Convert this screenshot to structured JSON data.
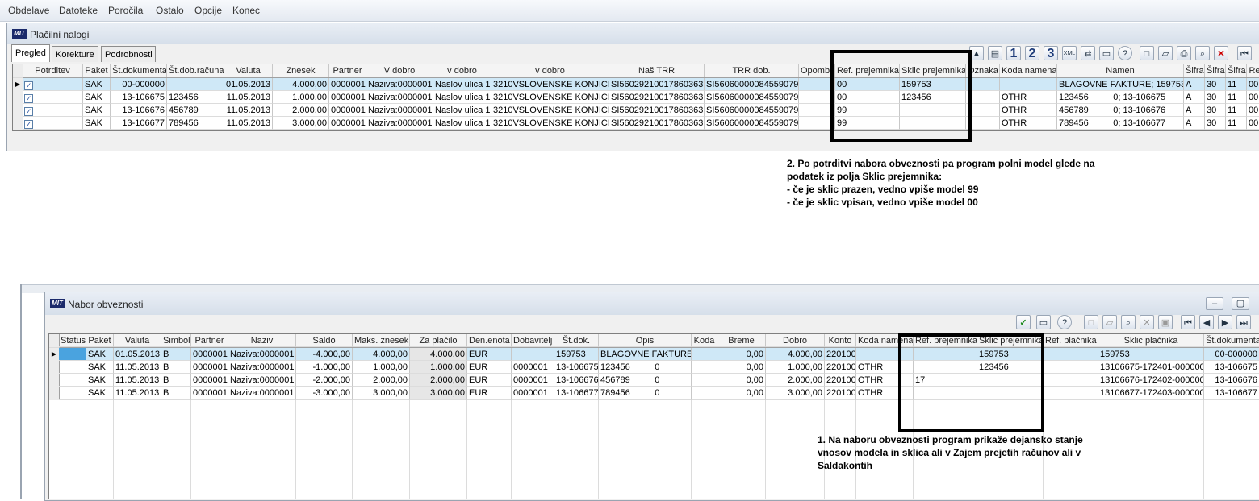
{
  "menu": [
    "Obdelave",
    "Datoteke",
    "Poročila",
    "Ostalo",
    "Opcije",
    "Konec"
  ],
  "window1": {
    "title": "Plačilni nalogi",
    "tabs": [
      "Pregled",
      "Korekture",
      "Podrobnosti"
    ],
    "toolbar_numbers": [
      "1",
      "2",
      "3"
    ],
    "columns": [
      "Potrditev",
      "Paket",
      "Št.dokumenta",
      "Št.dob.računa",
      "Valuta",
      "Znesek",
      "Partner",
      "V dobro",
      "v dobro",
      "v dobro",
      "Naš TRR",
      "TRR dob.",
      "Opomba",
      "Ref. prejemnika",
      "Sklic prejemnika",
      "Oznaka",
      "Koda namena",
      "Namen",
      "Šifra",
      "Šifra",
      "Šifra",
      "Re"
    ],
    "rows": [
      [
        "SAK",
        "00-000000",
        "",
        "01.05.2013",
        "4.000,00",
        "0000001",
        "Naziva:0000001",
        "Naslov ulica 1",
        "3210VSLOVENSKE KONJICE",
        "SI56029210017860363",
        "SI56060000084559079",
        "",
        "00",
        "159753",
        "",
        "",
        "BLAGOVNE FAKTURE; 159753",
        "A",
        "30",
        "11",
        "00"
      ],
      [
        "SAK",
        "13-106675",
        "123456",
        "11.05.2013",
        "1.000,00",
        "0000001",
        "Naziva:0000001",
        "Naslov ulica 1",
        "3210VSLOVENSKE KONJICE",
        "SI56029210017860363",
        "SI56060000084559079",
        "",
        "00",
        "123456",
        "",
        "OTHR",
        "123456          0; 13-106675",
        "A",
        "30",
        "11",
        "00"
      ],
      [
        "SAK",
        "13-106676",
        "456789",
        "11.05.2013",
        "2.000,00",
        "0000001",
        "Naziva:0000001",
        "Naslov ulica 1",
        "3210VSLOVENSKE KONJICE",
        "SI56029210017860363",
        "SI56060000084559079",
        "",
        "99",
        "",
        "",
        "OTHR",
        "456789          0; 13-106676",
        "A",
        "30",
        "11",
        "00"
      ],
      [
        "SAK",
        "13-106677",
        "789456",
        "11.05.2013",
        "3.000,00",
        "0000001",
        "Naziva:0000001",
        "Naslov ulica 1",
        "3210VSLOVENSKE KONJICE",
        "SI56029210017860363",
        "SI56060000084559079",
        "",
        "99",
        "",
        "",
        "OTHR",
        "789456          0; 13-106677",
        "A",
        "30",
        "11",
        "00"
      ]
    ]
  },
  "note2": {
    "lines": [
      "2. Po potrditvi nabora obveznosti pa program polni model glede na",
      "podatek iz polja Sklic prejemnika:",
      "- če je sklic prazen, vedno vpiše model 99",
      "- če je sklic vpisan, vedno vpiše model 00"
    ]
  },
  "window2": {
    "title": "Nabor obveznosti",
    "columns": [
      "Status",
      "Paket",
      "Valuta",
      "Simbol",
      "Partner",
      "Naziv",
      "Saldo",
      "Maks. znesek",
      "Za plačilo",
      "Den.enota",
      "Dobavitelj",
      "Št.dok.",
      "Opis",
      "Koda",
      "Breme",
      "Dobro",
      "Konto",
      "Koda namena",
      "Ref. prejemnika",
      "Sklic prejemnika",
      "Ref. plačnika",
      "Sklic plačnika",
      "Št.dokumenta"
    ],
    "rows": [
      [
        "",
        "SAK",
        "01.05.2013",
        "B",
        "0000001",
        "Naziva:0000001",
        "-4.000,00",
        "4.000,00",
        "4.000,00",
        "EUR",
        "",
        "159753",
        "BLAGOVNE FAKTURE",
        "",
        "0,00",
        "4.000,00",
        "220100",
        "",
        "",
        "159753",
        "",
        "159753",
        "00-000000"
      ],
      [
        "",
        "SAK",
        "11.05.2013",
        "B",
        "0000001",
        "Naziva:0000001",
        "-1.000,00",
        "1.000,00",
        "1.000,00",
        "EUR",
        "0000001",
        "13-106675",
        "123456          0",
        "",
        "0,00",
        "1.000,00",
        "220100",
        "OTHR",
        "",
        "123456",
        "",
        "13106675-172401-000000",
        "13-106675"
      ],
      [
        "",
        "SAK",
        "11.05.2013",
        "B",
        "0000001",
        "Naziva:0000001",
        "-2.000,00",
        "2.000,00",
        "2.000,00",
        "EUR",
        "0000001",
        "13-106676",
        "456789          0",
        "",
        "0,00",
        "2.000,00",
        "220100",
        "OTHR",
        "17",
        "",
        "",
        "13106676-172402-000000",
        "13-106676"
      ],
      [
        "",
        "SAK",
        "11.05.2013",
        "B",
        "0000001",
        "Naziva:0000001",
        "-3.000,00",
        "3.000,00",
        "3.000,00",
        "EUR",
        "0000001",
        "13-106677",
        "789456          0",
        "",
        "0,00",
        "3.000,00",
        "220100",
        "OTHR",
        "",
        "",
        "",
        "13106677-172403-000000",
        "13-106677"
      ]
    ]
  },
  "note1": {
    "lines": [
      "1. Na naboru obveznosti program prikaže dejansko stanje",
      "vnosov modela in sklica ali v Zajem prejetih računov ali v",
      "Saldakontih"
    ]
  }
}
